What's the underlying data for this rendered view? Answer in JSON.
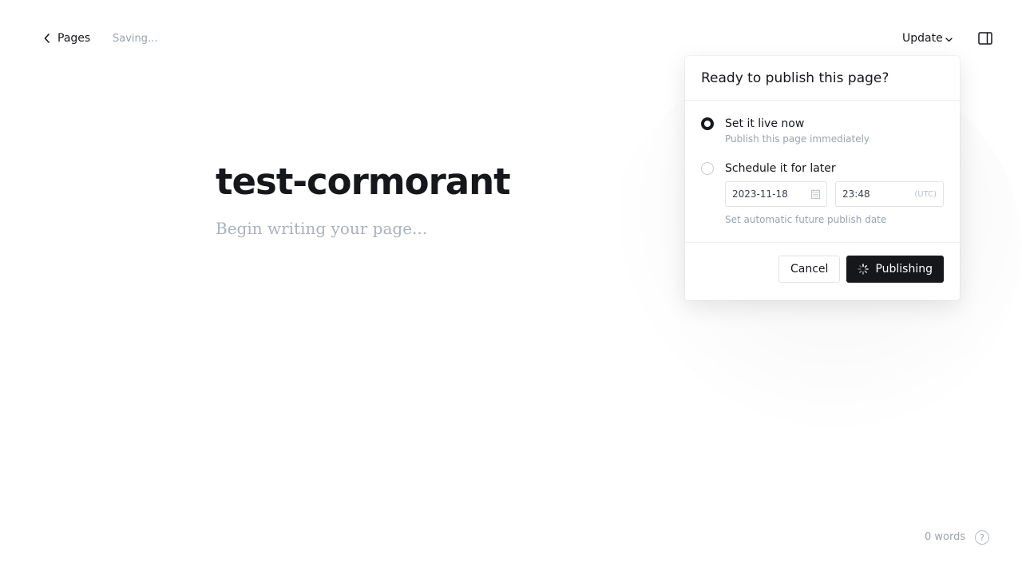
{
  "topbar": {
    "back_label": "Pages",
    "status": "Saving...",
    "update_label": "Update"
  },
  "editor": {
    "title": "test-cormorant",
    "body_placeholder": "Begin writing your page..."
  },
  "publish_menu": {
    "heading": "Ready to publish this page?",
    "options": [
      {
        "title": "Set it live now",
        "description": "Publish this page immediately",
        "selected": true
      },
      {
        "title": "Schedule it for later",
        "description": "Set automatic future publish date",
        "selected": false
      }
    ],
    "schedule": {
      "date": "2023-11-18",
      "time": "23:48",
      "timezone": "(UTC)"
    },
    "cancel_label": "Cancel",
    "publish_label": "Publishing"
  },
  "footer": {
    "word_count": "0 words",
    "help_glyph": "?"
  },
  "icons": {
    "back": "chevron-left-icon",
    "update_caret": "chevron-down-icon",
    "sidebar": "sidebar-toggle-icon",
    "calendar": "calendar-icon",
    "spinner": "spinner-icon",
    "help": "help-icon"
  },
  "colors": {
    "primary_text": "#15171a",
    "muted_text": "#9aa3ad",
    "button_dark": "#15171a",
    "border": "#dfe3e7"
  }
}
